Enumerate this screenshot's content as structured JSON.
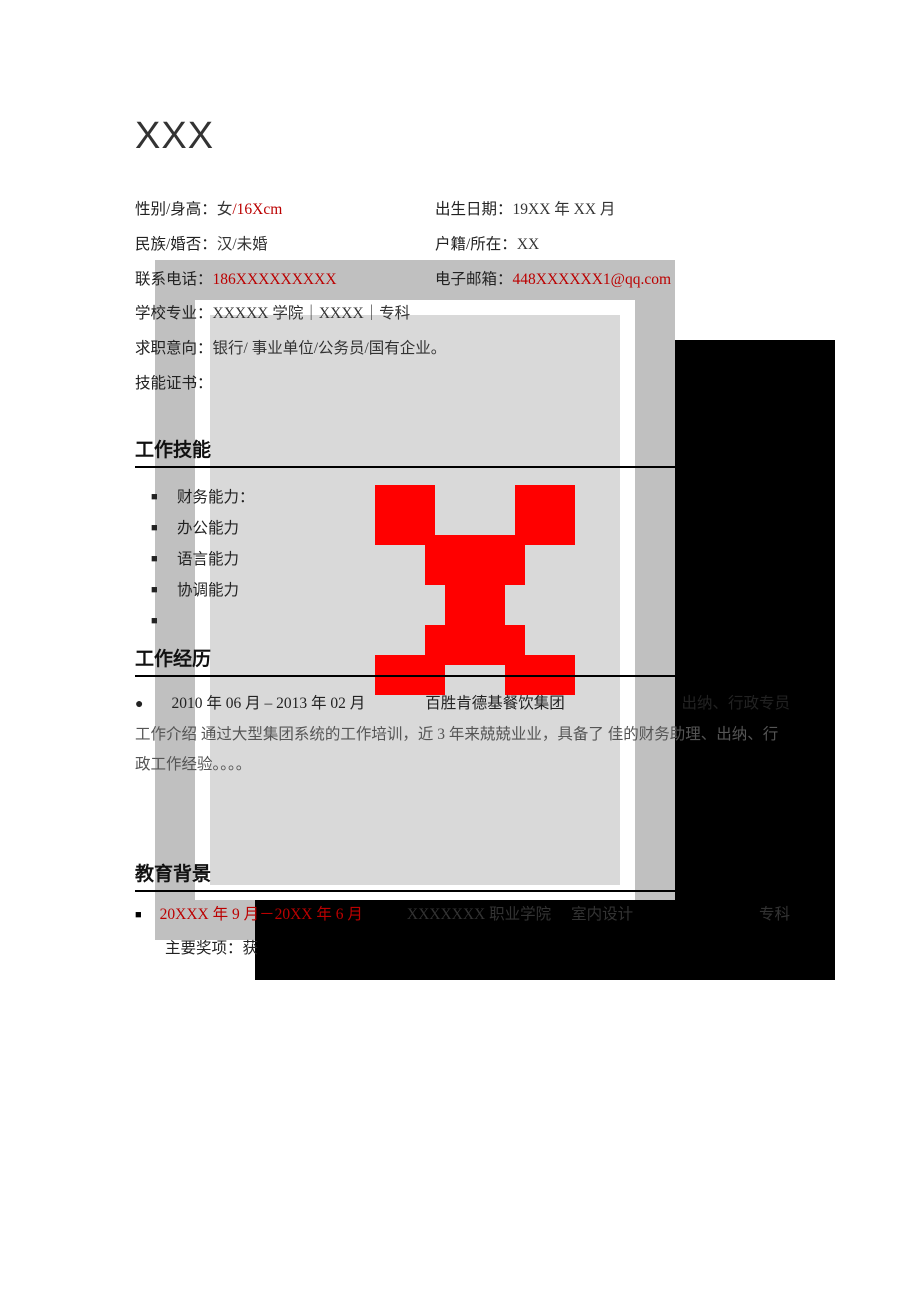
{
  "name": "XXX",
  "info": {
    "gender_height_label": "性别/身高：",
    "gender": "女",
    "height_sep": "/",
    "height": "16Xcm",
    "birth_label": "出生日期：",
    "birth": "19XX 年 XX 月",
    "ethnic_label": "民族/婚否：",
    "ethnic": "汉/未婚",
    "registry_label": "户籍/所在：",
    "registry": "XX",
    "phone_label": "联系电话：",
    "phone": "186XXXXXXXXX",
    "email_label": "电子邮箱：",
    "email": "448XXXXXX1@qq.com",
    "school_label": "学校专业：",
    "school": "XXXXX 学院｜XXXX｜专科",
    "intention_label": "求职意向：",
    "intention": "银行/ 事业单位/公务员/国有企业。",
    "cert_label": "技能证书："
  },
  "sections": {
    "skills_title": "工作技能",
    "exp_title": "工作经历",
    "edu_title": "教育背景"
  },
  "skills": [
    "财务能力：",
    "办公能力",
    "语言能力",
    "协调能力",
    ""
  ],
  "experience": {
    "date": "2010 年 06 月 – 2013 年 02 月",
    "company": "百胜肯德基餐饮集团",
    "role": "出纳、行政专员",
    "desc": "工作介绍  通过大型集团系统的工作培训，近 3 年来兢兢业业，具备了     佳的财务助理、出纳、行政工作经验。。。。"
  },
  "education": {
    "dates": "20XXX 年 9 月－20XX 年 6 月",
    "school": "XXXXXXX 职业学院",
    "major": "室内设计",
    "degree": "专科",
    "awards_label": "主要奖项：获"
  }
}
